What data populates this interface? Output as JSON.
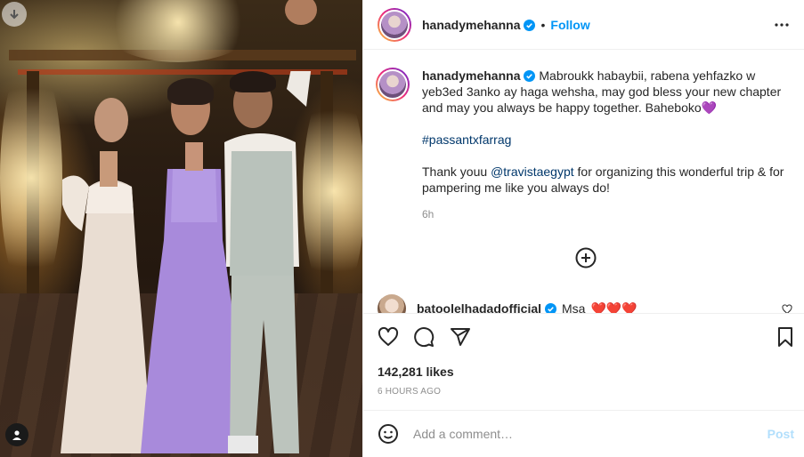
{
  "post": {
    "author": "hanadymehanna",
    "follow_label": "Follow",
    "separator": "•",
    "caption_lines": [
      "Mabroukk habaybii, rabena yehfazko w yeb3ed 3anko ay haga wehsha, may god bless your new chapter and may you always be happy together. Baheboko"
    ],
    "caption_emoji": "💜",
    "hashtag": "#passantxfarrag",
    "thanks_prefix": "Thank youu ",
    "thanks_mention": "@travistaegypt",
    "thanks_suffix": " for organizing this wonderful trip & for pampering me like you always do!",
    "caption_time": "6h"
  },
  "comment": {
    "username": "batoolelhadadofficial",
    "text": "Msa",
    "hearts": "❤️❤️❤️"
  },
  "stats": {
    "likes": "142,281 likes",
    "posted_ago": "6 HOURS AGO"
  },
  "composer": {
    "placeholder": "Add a comment…",
    "post_label": "Post"
  },
  "colors": {
    "accent": "#0095f6",
    "link": "#00376b",
    "post_disabled": "#b2dffc",
    "heart_red": "#ed4956"
  },
  "icons": [
    "more-horizontal-icon",
    "load-more-plus-icon",
    "heart-icon",
    "comment-icon",
    "share-icon",
    "bookmark-icon",
    "emoji-icon",
    "verified-icon",
    "user-tag-icon"
  ]
}
